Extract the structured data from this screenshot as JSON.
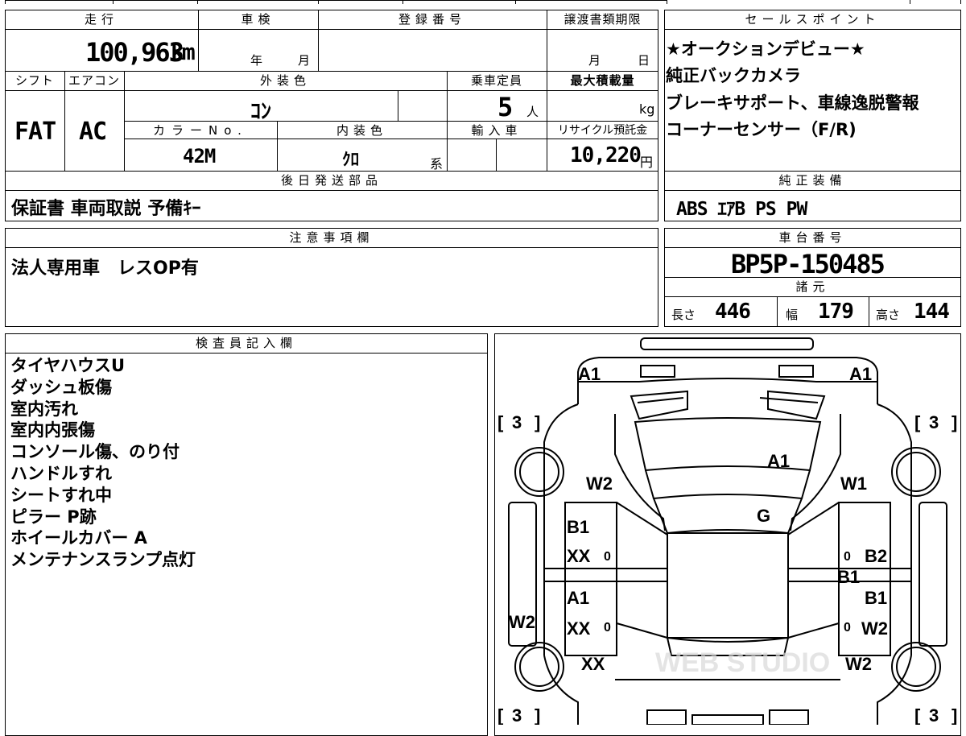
{
  "mileage": {
    "header": "走行",
    "value": "100,963",
    "unit": "km"
  },
  "inspection": {
    "header": "車検",
    "year_label": "年",
    "month_label": "月"
  },
  "registration": {
    "header": "登録番号",
    "value": ""
  },
  "transfer_deadline": {
    "header": "譲渡書類期限",
    "month_label": "月",
    "day_label": "日"
  },
  "shift": {
    "header": "シフト",
    "value": "FAT"
  },
  "aircon": {
    "header": "エアコン",
    "value": "AC"
  },
  "exterior_color": {
    "header": "外装色",
    "value": "ｺﾝ"
  },
  "capacity": {
    "header": "乗車定員",
    "value": "5",
    "unit": "人"
  },
  "max_load": {
    "header": "最大積載量",
    "value": "",
    "unit": "kg"
  },
  "color_no": {
    "header": "カラーNo.",
    "value": "42M"
  },
  "interior_color": {
    "header": "内装色",
    "value": "ｸﾛ",
    "suffix": "系"
  },
  "import": {
    "header": "輸入車",
    "value": ""
  },
  "recycle": {
    "header": "リサイクル預託金",
    "value": "10,220",
    "unit": "円"
  },
  "later_parts": {
    "header": "後日発送部品",
    "value": "保証書 車両取説 予備ｷｰ"
  },
  "sales_points": {
    "header": "セールスポイント",
    "lines": [
      "★オークションデビュー★",
      "純正バックカメラ",
      "ブレーキサポート、車線逸脱警報",
      "コーナーセンサー（F/R)"
    ]
  },
  "factory_equipment": {
    "header": "純正装備",
    "value": "ABS ｴｱB PS PW"
  },
  "notes": {
    "header": "注意事項欄",
    "value": "法人専用車　レスOP有"
  },
  "chassis": {
    "header": "車台番号",
    "value": "BP5P-150485"
  },
  "specs": {
    "header": "諸元",
    "length_label": "長さ",
    "length": "446",
    "width_label": "幅",
    "width": "179",
    "height_label": "高さ",
    "height": "144"
  },
  "inspector": {
    "header": "検査員記入欄",
    "lines": [
      "タイヤハウスU",
      "ダッシュ板傷",
      "室内汚れ",
      "室内内張傷",
      "コンソール傷、のり付",
      "ハンドルすれ",
      "シートすれ中",
      "ピラー P跡",
      "ホイールカバー A",
      "メンテナンスランプ点灯"
    ]
  },
  "diagram": {
    "marks": {
      "front_left": "A1",
      "front_right": "A1",
      "tire_fl": "3",
      "tire_fr": "3",
      "tire_rl": "3",
      "tire_rr": "3",
      "hood": "A1",
      "windshield": "G",
      "fender_left": "W2",
      "fender_right": "W1",
      "door_fl_1": "B1",
      "door_fl_2": "XX",
      "door_rl_1": "A1",
      "door_rl_2": "XX",
      "door_fr_1": "B2",
      "door_fr_2": "B1",
      "door_rr_1": "B1",
      "door_rr_2": "W2",
      "sill_left": "W2",
      "rear_left": "XX",
      "rear_right": "W2",
      "mirror_mark": "0"
    },
    "watermark": "WEB STUDIO"
  }
}
